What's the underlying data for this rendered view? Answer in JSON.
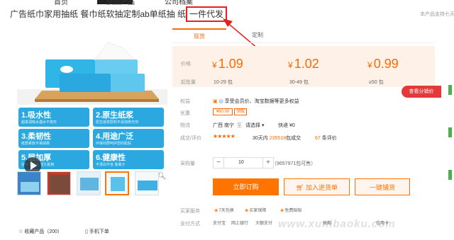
{
  "nav": {
    "items": [
      "首页",
      "供应产品",
      "公司档案"
    ]
  },
  "product": {
    "title": "广告纸巾家用抽纸 餐巾纸软抽定制ab单纸抽 纸巾批发",
    "highlight": "一件代发",
    "notice": "本产品支持七天"
  },
  "tabs": [
    "现货",
    "定制"
  ],
  "prices": {
    "price_label": "价格",
    "qty_label": "起批量",
    "items": [
      {
        "yen": "¥",
        "value": "1.09",
        "qty": "10-29 包"
      },
      {
        "yen": "¥",
        "value": "1.02",
        "qty": "30-49 包"
      },
      {
        "yen": "¥",
        "value": "0.99",
        "qty": "≥50 包"
      }
    ],
    "tiered_button": "查看分销价"
  },
  "rows": {
    "rights_label": "权益",
    "rights_value": "享受会员价、淘宝数据等更多权益",
    "discount_label": "优惠",
    "coupon": "¥80.00",
    "coupon_get": "领取",
    "logistics_label": "物流",
    "logistics_from": "广西 南宁",
    "logistics_to_prefix": "至",
    "logistics_to": "请选择",
    "logistics_express": "快递 ¥0",
    "rating_label": "成交/评价",
    "stars": "★★★★★",
    "sales_prefix": "30天内",
    "sales_count": "235518",
    "sales_unit": "包成交",
    "reviews_count": "67",
    "reviews_unit": "条评价",
    "qty_label": "采购量",
    "qty_value": "10",
    "stock": "（9657971包可售）"
  },
  "buttons": {
    "buy_now": "立即订购",
    "add_cart": "加入进货单",
    "one_click": "一键铺货"
  },
  "services": {
    "label": "买家服务",
    "items": [
      "7天包换",
      "买家保障",
      "免费赔赔"
    ]
  },
  "payment": {
    "label": "支付方式",
    "items": [
      "支付宝",
      "网上银行",
      "大额支付",
      "账期",
      "信用卡"
    ]
  },
  "watermark": "www.xunibaoku.com",
  "features": [
    {
      "title": "1.吸水性",
      "desc": "超柔润吸水遇水不变形"
    },
    {
      "title": "2.原生纸浆",
      "desc": "原生纸浆原料不添加荧光剂"
    },
    {
      "title": "3.柔韧性",
      "desc": "纸质柔软不易掉屑"
    },
    {
      "title": "4.用途广泛",
      "desc": "环保材质呵护您的肌肤"
    },
    {
      "title": "5.层加厚",
      "desc": "加厚不易破 经久耐用"
    },
    {
      "title": "6.健康性",
      "desc": "不漂白不含 氯离子"
    }
  ],
  "footer": {
    "favorite": "收藏产品（200）",
    "mobile": "手机下单"
  },
  "colors": {
    "accent": "#ff6a00",
    "button": "#ff7300",
    "feature_blue": "#2aa8df",
    "highlight_border": "#e52222"
  }
}
